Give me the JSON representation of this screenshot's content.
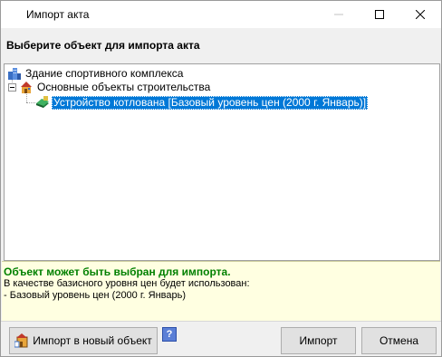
{
  "window": {
    "title": "Импорт акта",
    "controls": {
      "minimize": "minimize",
      "maximize": "maximize",
      "close": "close"
    }
  },
  "header": {
    "label": "Выберите объект для импорта акта"
  },
  "tree": {
    "items": [
      {
        "label": "Здание спортивного комплекса",
        "icon": "building-icon",
        "level": 0
      },
      {
        "label": "Основные объекты строительства",
        "icon": "construction-objects-icon",
        "level": 0,
        "expanded": true
      },
      {
        "label": "Устройство котлована [Базовый уровень цен (2000 г. Январь)]",
        "icon": "estimate-book-icon",
        "level": 1,
        "selected": true
      }
    ]
  },
  "info": {
    "status": "Объект может быть выбран для импорта.",
    "line1": "В качестве базисного уровня цен будет использован:",
    "line2": "- Базовый уровень цен (2000 г. Январь)"
  },
  "buttons": {
    "import_new": "Импорт в новый объект",
    "help": "?",
    "import": "Импорт",
    "cancel": "Отмена"
  },
  "colors": {
    "selection": "#0078d7",
    "info_background": "#ffffe1",
    "status_text": "#008000"
  }
}
